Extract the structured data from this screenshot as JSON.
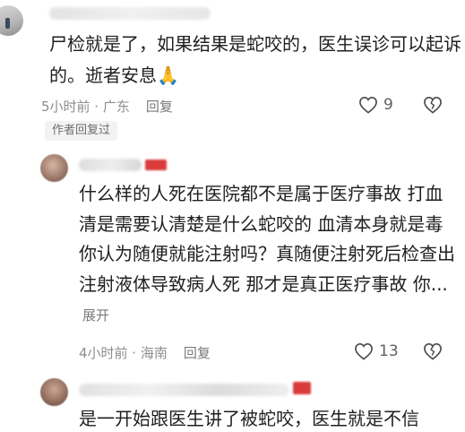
{
  "comment": {
    "text": "尸检就是了，如果结果是蛇咬的，医生误诊可以起诉的。逝者安息🙏",
    "time_location": "5小时前 · 广东",
    "reply_label": "回复",
    "likes": "9",
    "author_replied_tag": "作者回复过"
  },
  "reply1": {
    "text": "什么样的人死在医院都不是属于医疗事故 打血清是需要认清楚是什么蛇咬的  血清本身就是毒  你认为随便就能注射吗？真随便注射死后检查出注射液体导致病人死 那才是真正医疗事故  你...",
    "expand_label": "展开",
    "time_location": "4小时前 · 海南",
    "reply_label": "回复",
    "likes": "13"
  },
  "reply2": {
    "text": "是一开始跟医生讲了被蛇咬，医生就是不信"
  },
  "colors": {
    "text": "#1f1f1f",
    "meta": "#8d8d8d",
    "badge_red": "#d93b3b"
  }
}
